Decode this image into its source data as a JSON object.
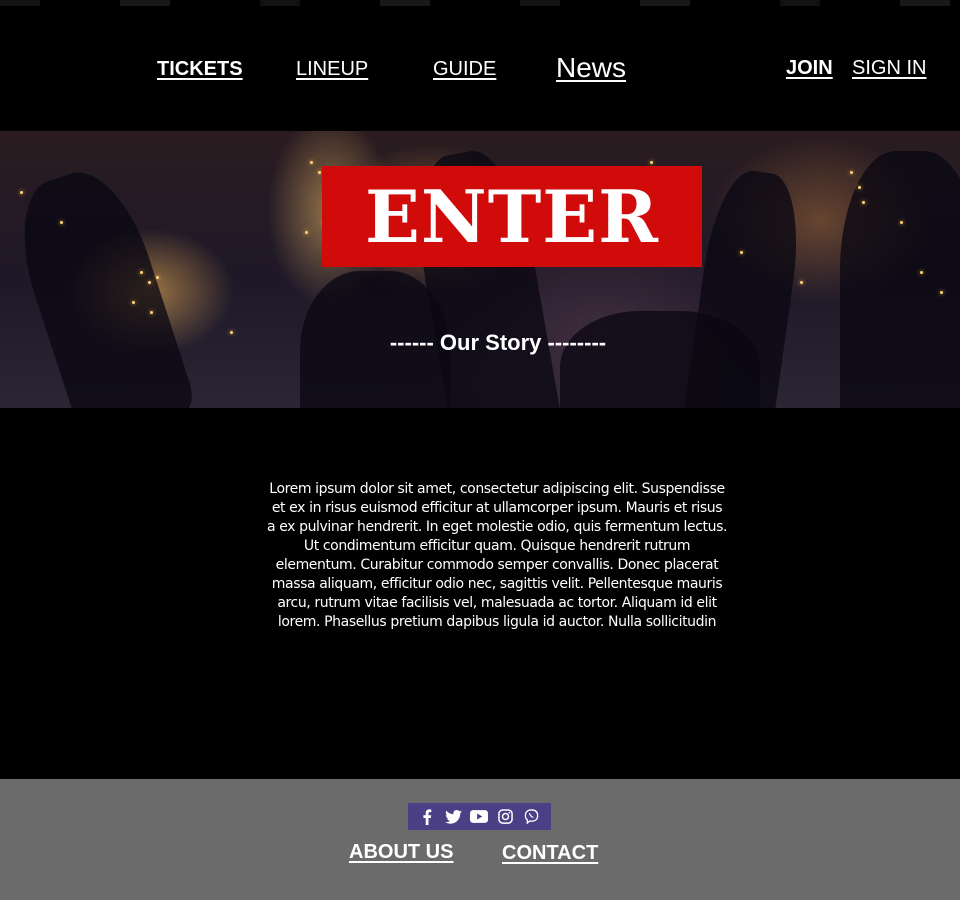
{
  "nav": {
    "tickets": "TICKETS",
    "lineup": "LINEUP",
    "guide": "GUIDE",
    "news": "News"
  },
  "auth": {
    "join": "JOIN",
    "sign_in": "SIGN IN"
  },
  "hero": {
    "logo_text": "ENTER",
    "logo_color": "#d10a0a",
    "subtitle": "------ Our Story --------"
  },
  "content": {
    "body": "Lorem ipsum dolor sit amet, consectetur adipiscing elit. Suspendisse et ex in risus euismod efficitur at ullamcorper ipsum. Mauris et risus a ex pulvinar hendrerit. In eget molestie odio, quis fermentum lectus. Ut condimentum efficitur quam. Quisque hendrerit rutrum elementum. Curabitur commodo semper convallis. Donec placerat massa aliquam, efficitur odio nec, sagittis velit. Pellentesque mauris arcu, rutrum vitae facilisis vel, malesuada ac tortor. Aliquam id elit lorem. Phasellus pretium dapibus ligula id auctor. Nulla sollicitudin"
  },
  "footer": {
    "social_icons": [
      "facebook-icon",
      "twitter-icon",
      "youtube-icon",
      "instagram-icon",
      "viber-icon"
    ],
    "social_bg": "#4b3f86",
    "background": "#6b6b6b",
    "about_us": "ABOUT US",
    "contact": "CONTACT"
  }
}
